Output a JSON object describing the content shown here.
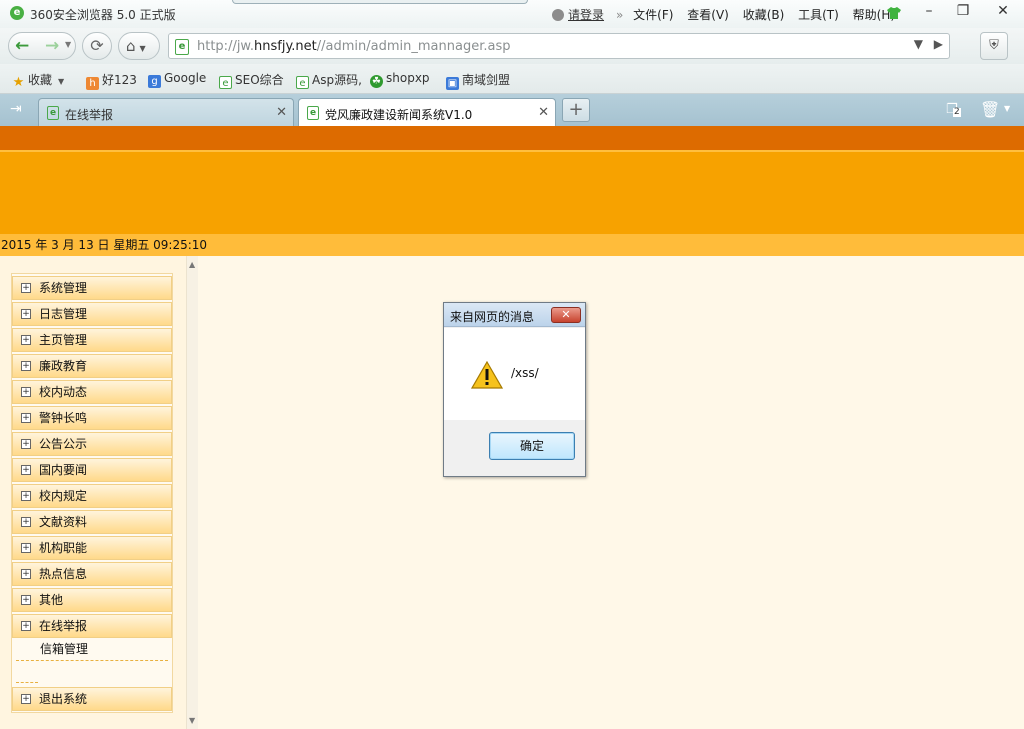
{
  "window": {
    "title": "360安全浏览器 5.0 正式版",
    "login": "请登录",
    "menus": [
      "文件(F)",
      "查看(V)",
      "收藏(B)",
      "工具(T)",
      "帮助(H)"
    ]
  },
  "address": {
    "url_prefix": "http://jw.",
    "url_host": "hnsfjy.net",
    "url_path": "//admin/admin_mannager.asp"
  },
  "bookmarks": {
    "favorites": "收藏",
    "items": [
      "好123",
      "Google",
      "SEO综合",
      "Asp源码,",
      "shopxp",
      "南域剑盟"
    ]
  },
  "tabs": [
    {
      "label": "在线举报"
    },
    {
      "label": "党风廉政建设新闻系统V1.0"
    }
  ],
  "tab_count": "2",
  "page": {
    "date": "2015 年 3 月 13 日 星期五 09:25:10",
    "menu": [
      "系统管理",
      "日志管理",
      "主页管理",
      "廉政教育",
      "校内动态",
      "警钟长鸣",
      "公告公示",
      "国内要闻",
      "校内规定",
      "文献资料",
      "机构职能",
      "热点信息",
      "其他",
      "在线举报"
    ],
    "submenu": [
      "信箱管理"
    ],
    "logout": "退出系统"
  },
  "dialog": {
    "title": "来自网页的消息",
    "message": "/xss/",
    "ok": "确定"
  },
  "colors": {
    "header_dark": "#dd6b00",
    "header_orange": "#f7a200",
    "datebar": "#ffbc3a",
    "content_bg": "#fff8e8"
  }
}
